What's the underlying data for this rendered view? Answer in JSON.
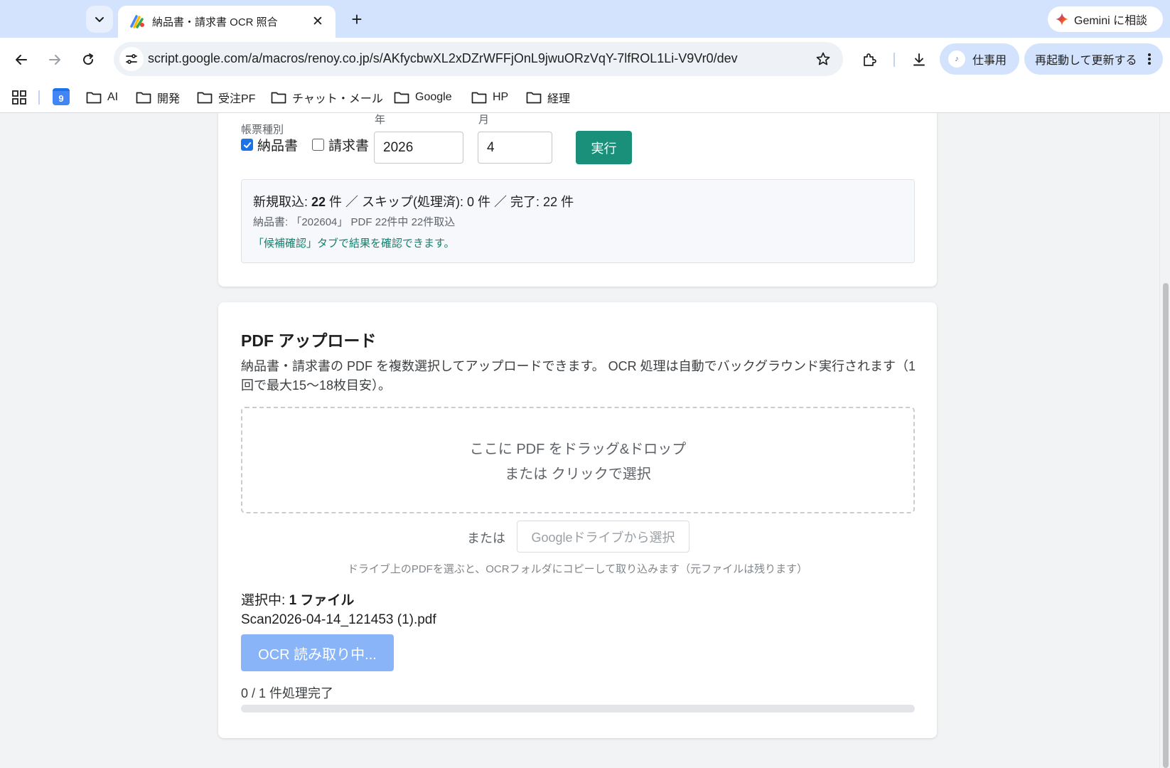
{
  "browser": {
    "tab_title": "納品書・請求書 OCR 照合",
    "url": "script.google.com/a/macros/renoy.co.jp/s/AKfycbwXL2xDZrWFFjOnL9jwuORzVqY-7lfROL1Li-V9Vr0/dev",
    "gemini_label": "Gemini に相談",
    "profile_label": "仕事用",
    "update_label": "再起動して更新する",
    "bookmarks": [
      "AI",
      "開発",
      "受注PF",
      "チャット・メール",
      "Google",
      "HP",
      "経理"
    ],
    "calendar_day": "9"
  },
  "run_form": {
    "type_label": "帳票種別",
    "checkbox_delivery": "納品書",
    "checkbox_invoice": "請求書",
    "delivery_checked": true,
    "invoice_checked": false,
    "year_label": "年",
    "year_value": "2026",
    "month_label": "月",
    "month_value": "4",
    "run_button": "実行"
  },
  "result": {
    "new_prefix": "新規取込: ",
    "new_count": "22",
    "rest": " 件 ／ スキップ(処理済): 0 件 ／ 完了: 22 件",
    "detail": "納品書: 「202604」 PDF 22件中 22件取込",
    "hint": "「候補確認」タブで結果を確認できます。"
  },
  "upload": {
    "title": "PDF アップロード",
    "description": "納品書・請求書の PDF を複数選択してアップロードできます。 OCR 処理は自動でバックグラウンド実行されます（1回で最大15〜18枚目安）。",
    "drop_line1": "ここに PDF をドラッグ&ドロップ",
    "drop_line2": "または クリックで選択",
    "or_label": "または",
    "drive_button": "Googleドライブから選択",
    "drive_note": "ドライブ上のPDFを選ぶと、OCRフォルダにコピーして取り込みます（元ファイルは残ります）",
    "selected_prefix": "選択中: ",
    "selected_count": "1 ファイル",
    "filename": "Scan2026-04-14_121453 (1).pdf",
    "ocr_button": "OCR 読み取り中...",
    "progress_text": "0 / 1 件処理完了",
    "progress_fraction": 0
  },
  "colors": {
    "accent_green": "#1a8f7a",
    "primary_disabled": "#8ab4f8",
    "tabstrip": "#d3e3fd"
  }
}
